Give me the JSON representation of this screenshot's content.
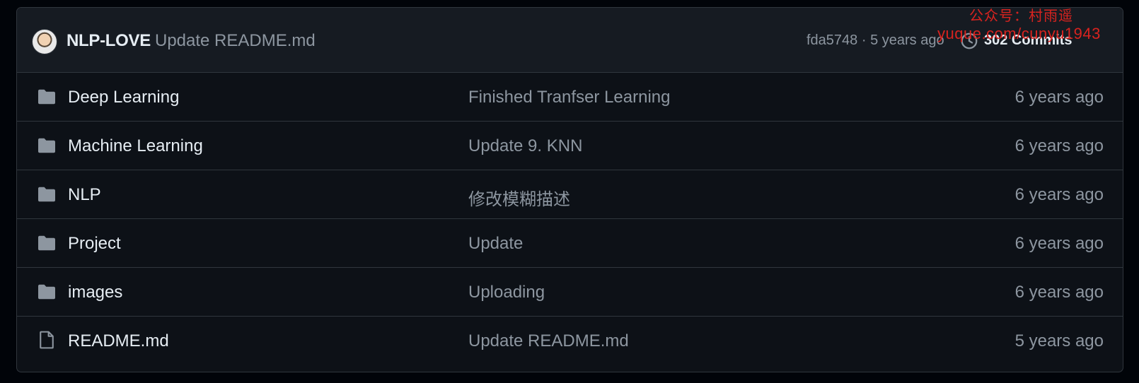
{
  "latest_commit": {
    "author": "NLP-LOVE",
    "message": "Update README.md",
    "meta": "fda5748 · 5 years ago",
    "commits_label": "302 Commits"
  },
  "watermark": {
    "line1": "公众号：村雨遥",
    "line2": "yuque.com/cunyu1943"
  },
  "files": [
    {
      "type": "folder",
      "icon": "folder-icon",
      "name": "Deep Learning",
      "message": "Finished Tranfser Learning",
      "age": "6 years ago"
    },
    {
      "type": "folder",
      "icon": "folder-icon",
      "name": "Machine Learning",
      "message": "Update 9. KNN",
      "age": "6 years ago"
    },
    {
      "type": "folder",
      "icon": "folder-icon",
      "name": "NLP",
      "message": "修改模糊描述",
      "age": "6 years ago"
    },
    {
      "type": "folder",
      "icon": "folder-icon",
      "name": "Project",
      "message": "Update",
      "age": "6 years ago"
    },
    {
      "type": "folder",
      "icon": "folder-icon",
      "name": "images",
      "message": "Uploading",
      "age": "6 years ago"
    },
    {
      "type": "file",
      "icon": "file-icon",
      "name": "README.md",
      "message": "Update README.md",
      "age": "5 years ago"
    }
  ],
  "colors": {
    "background": "#0d1117",
    "header": "#161b22",
    "border": "#30363d",
    "text": "#e6edf3",
    "muted": "#8d96a0",
    "watermark": "#d8231f"
  }
}
